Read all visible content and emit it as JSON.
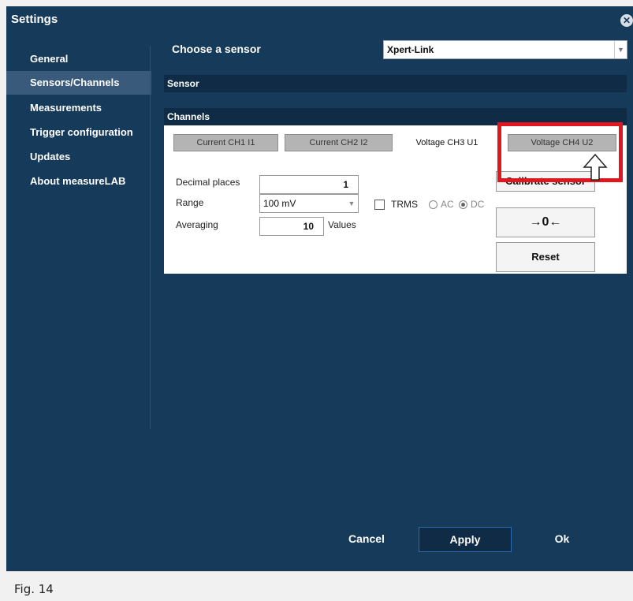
{
  "window": {
    "title": "Settings"
  },
  "sidebar": {
    "items": [
      {
        "label": "General",
        "active": false
      },
      {
        "label": "Sensors/Channels",
        "active": true
      },
      {
        "label": "Measurements",
        "active": false
      },
      {
        "label": "Trigger configuration",
        "active": false
      },
      {
        "label": "Updates",
        "active": false
      },
      {
        "label": "About measureLAB",
        "active": false
      }
    ]
  },
  "sensor": {
    "choose_label": "Choose a sensor",
    "selected": "Xpert-Link"
  },
  "sections": {
    "sensor": "Sensor",
    "channels": "Channels"
  },
  "tabs": [
    {
      "label": "Current CH1 I1",
      "active": false
    },
    {
      "label": "Current CH2 I2",
      "active": false
    },
    {
      "label": "Voltage CH3 U1",
      "active": true
    },
    {
      "label": "Voltage CH4 U2",
      "active": false
    }
  ],
  "channel": {
    "decimal_label": "Decimal places",
    "decimal_value": "1",
    "range_label": "Range",
    "range_value": "100 mV",
    "trms_label": "TRMS",
    "ac_label": "AC",
    "dc_label": "DC",
    "mode_selected": "DC",
    "averaging_label": "Averaging",
    "averaging_value": "10",
    "values_label": "Values"
  },
  "buttons": {
    "calibrate": "Calibrate sensor",
    "zero": "→0←",
    "reset": "Reset"
  },
  "footer": {
    "cancel": "Cancel",
    "apply": "Apply",
    "ok": "Ok"
  },
  "figure": {
    "caption": "Fig. 14"
  },
  "colors": {
    "background": "#163a5a",
    "highlight": "#e2161f",
    "active_side": "#3a5a7c"
  }
}
